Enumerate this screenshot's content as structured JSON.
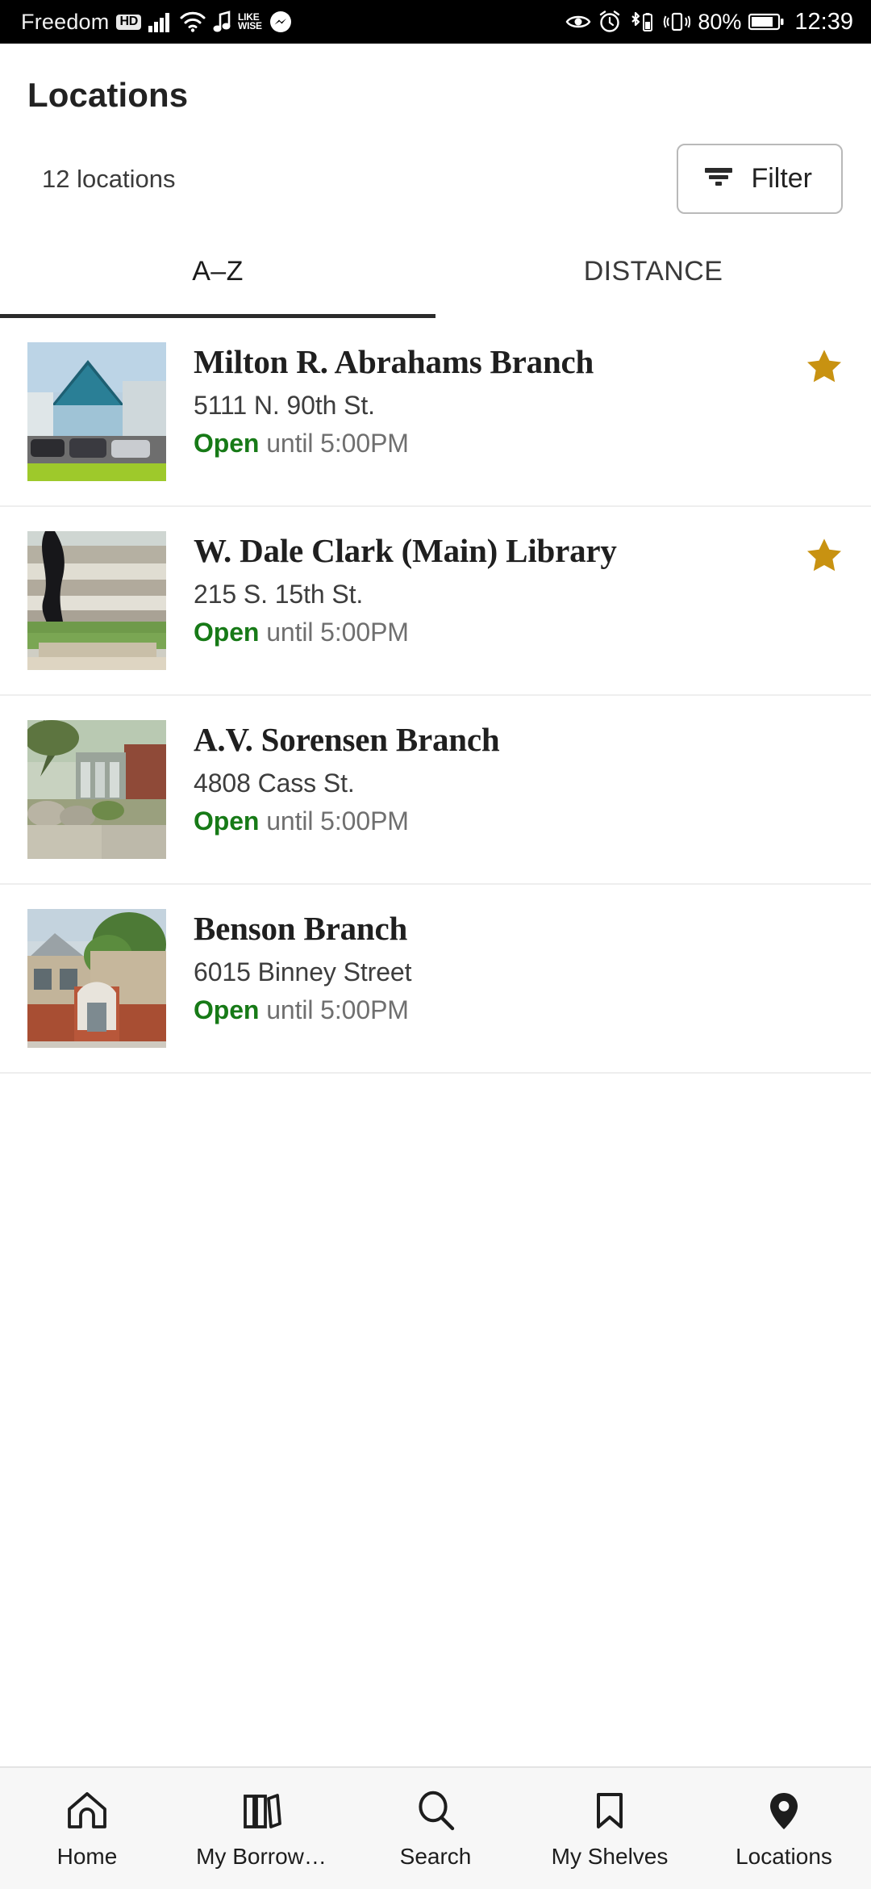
{
  "status_bar": {
    "carrier": "Freedom",
    "network_badge": "HD",
    "likewise_line1": "LIKE",
    "likewise_line2": "WISE",
    "battery_percent": "80%",
    "clock": "12:39",
    "icons": [
      "signal-icon",
      "wifi-icon",
      "music-note-icon",
      "likewise-icon",
      "messenger-icon",
      "eye-icon",
      "alarm-clock-icon",
      "bluetooth-battery-icon",
      "vibrate-icon",
      "battery-icon"
    ]
  },
  "header": {
    "title": "Locations"
  },
  "toolbar": {
    "count_label": "12 locations",
    "filter_label": "Filter"
  },
  "tabs": [
    {
      "label": "A–Z",
      "active": true
    },
    {
      "label": "DISTANCE",
      "active": false
    }
  ],
  "locations": [
    {
      "name": "Milton R. Abrahams Branch",
      "address": "5111 N. 90th St.",
      "status": "Open",
      "hours": "until 5:00PM",
      "favorite": true,
      "thumb": "glass-atrium-library"
    },
    {
      "name": "W. Dale Clark (Main) Library",
      "address": "215 S. 15th St.",
      "status": "Open",
      "hours": "until 5:00PM",
      "favorite": true,
      "thumb": "concrete-modern-library"
    },
    {
      "name": "A.V. Sorensen Branch",
      "address": "4808 Cass St.",
      "status": "Open",
      "hours": "until 5:00PM",
      "favorite": false,
      "thumb": "brick-library-with-trees"
    },
    {
      "name": "Benson Branch",
      "address": "6015 Binney Street",
      "status": "Open",
      "hours": "until 5:00PM",
      "favorite": false,
      "thumb": "red-brick-historic-library"
    }
  ],
  "bottom_nav": [
    {
      "label": "Home",
      "icon": "home-icon",
      "active": false
    },
    {
      "label": "My Borrow…",
      "icon": "books-icon",
      "active": false
    },
    {
      "label": "Search",
      "icon": "search-icon",
      "active": false
    },
    {
      "label": "My Shelves",
      "icon": "bookmark-icon",
      "active": false
    },
    {
      "label": "Locations",
      "icon": "map-pin-icon",
      "active": true
    }
  ],
  "colors": {
    "open_green": "#177a17",
    "star_gold": "#c89211",
    "status_bar_bg": "#000000",
    "tab_underline": "#2b2b2b"
  }
}
